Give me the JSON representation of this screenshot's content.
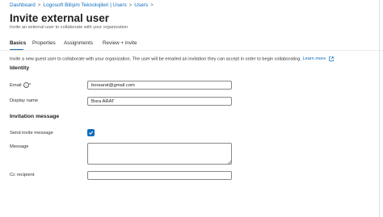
{
  "breadcrumb": {
    "items": [
      "Dashboard",
      "Logosoft Bilişim Teknolojileri | Users",
      "Users"
    ],
    "separator": ">"
  },
  "page": {
    "title": "Invite external user",
    "subtitle": "Invite an external user to collaborate with your organization"
  },
  "tabs": [
    {
      "label": "Basics",
      "active": true
    },
    {
      "label": "Properties",
      "active": false
    },
    {
      "label": "Assignments",
      "active": false
    },
    {
      "label": "Review + invite",
      "active": false
    }
  ],
  "intro": {
    "text": "Invite a new guest user to collaborate with your organization. The user will be emailed an invitation they can accept in order to begin collaborating.",
    "link": "Learn more"
  },
  "identity": {
    "heading": "Identity",
    "email_label": "Email",
    "required_mark": "*",
    "email_value": "boraarat@gmail.com",
    "display_name_label": "Display name",
    "display_name_value": "Bora ARAT"
  },
  "invitation": {
    "heading": "Invitation message",
    "send_label": "Send invite message",
    "send_checked": true,
    "message_label": "Message",
    "message_value": "",
    "cc_label": "Cc recipient",
    "cc_value": ""
  },
  "colors": {
    "accent": "#0f6cbd",
    "text": "#323130",
    "border": "#8a8886"
  },
  "icons": {
    "info": "info-icon",
    "external_link": "external-link-icon",
    "check": "checkmark-icon"
  }
}
